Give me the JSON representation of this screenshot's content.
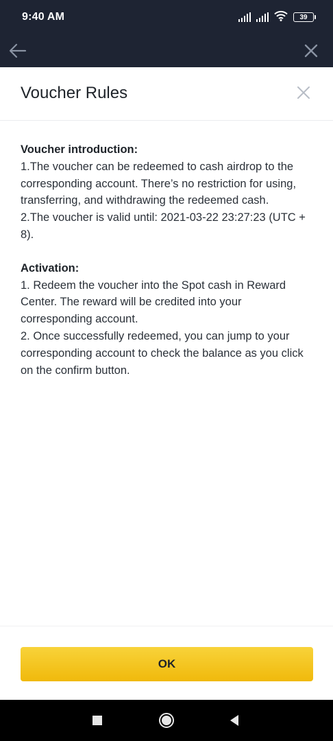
{
  "status_bar": {
    "time": "9:40 AM",
    "battery_level": "39"
  },
  "header_icons": [
    "arrow-left-icon",
    "close-icon"
  ],
  "sheet": {
    "title": "Voucher Rules",
    "close_icon": "close-icon"
  },
  "sections": [
    {
      "title": "Voucher introduction:",
      "lines": [
        "1.The voucher can be redeemed to cash airdrop to the corresponding account. There’s no restriction for using, transferring, and withdrawing the redeemed cash.",
        "2.The voucher is valid until: 2021-03-22 23:27:23 (UTC + 8)."
      ]
    },
    {
      "title": "Activation:",
      "lines": [
        "1. Redeem the voucher into the Spot cash in Reward Center. The reward will be credited into your corresponding account.",
        "2. Once successfully redeemed, you can jump to your corresponding account to check the balance as you click on the confirm button."
      ]
    }
  ],
  "footer": {
    "ok_label": "OK"
  },
  "nav_bar_icons": [
    "recents-icon",
    "home-icon",
    "back-icon"
  ],
  "colors": {
    "header_bg": "#1e2433",
    "accent": "#f0b90b",
    "text": "#1e2329"
  }
}
